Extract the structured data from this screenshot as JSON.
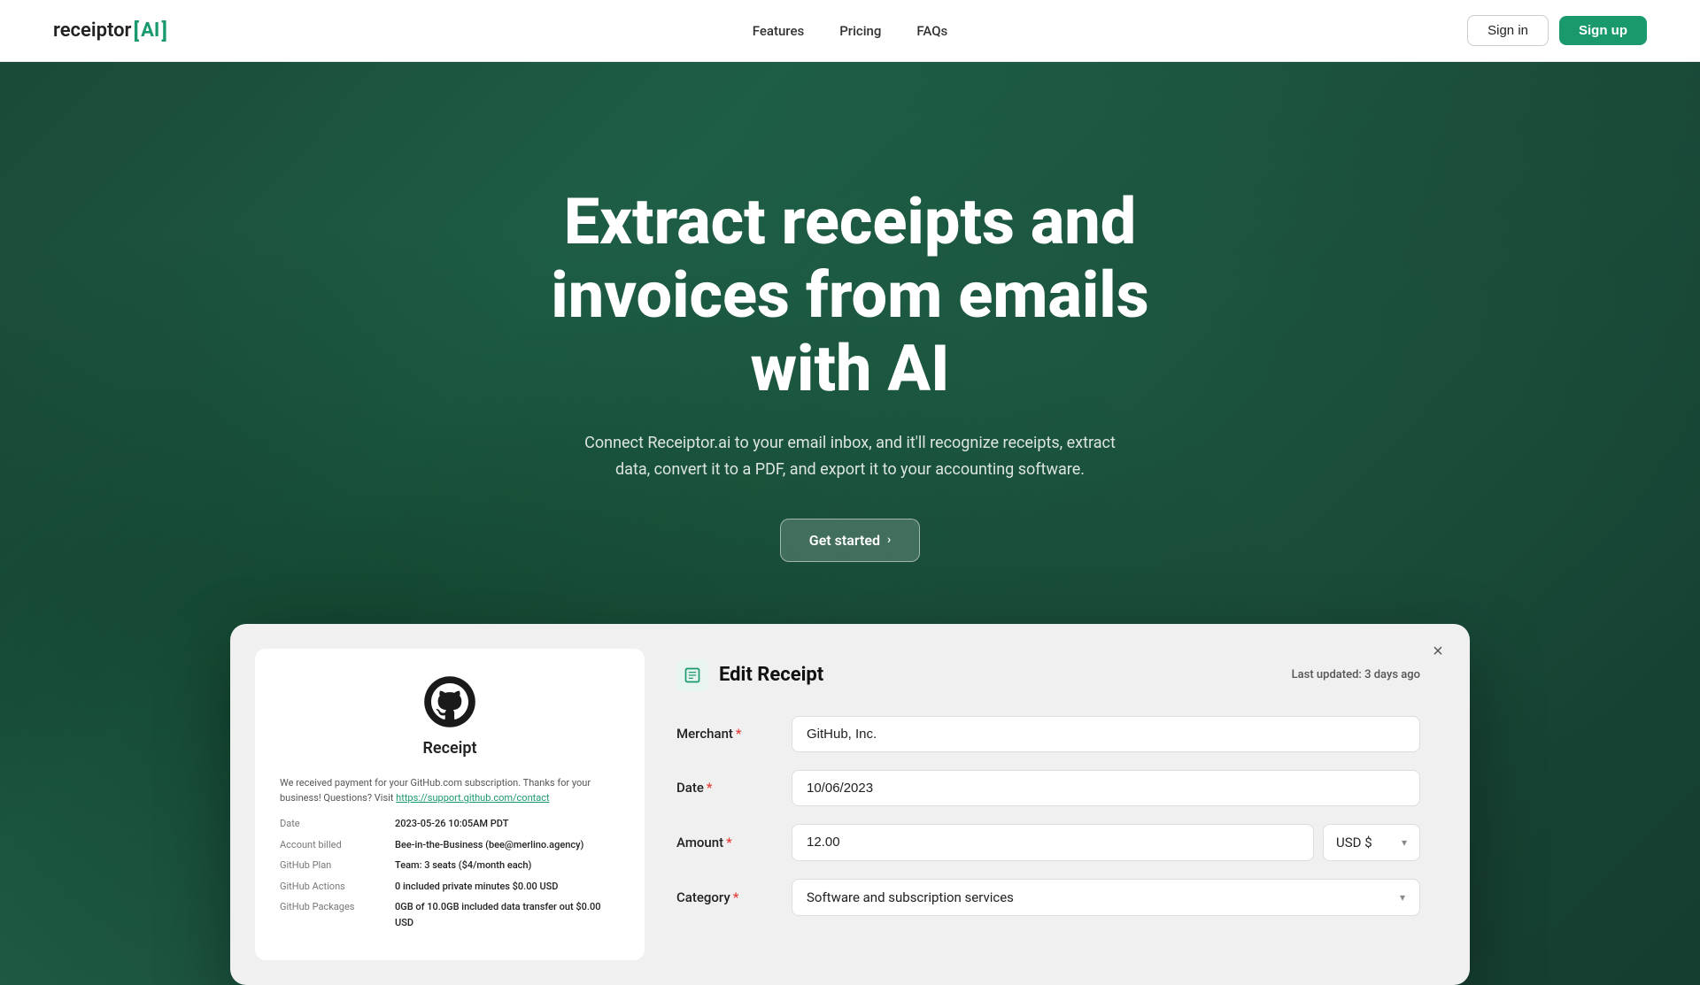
{
  "nav": {
    "logo_text": "receiptor",
    "logo_bracket_open": "[",
    "logo_ai": "AI",
    "logo_bracket_close": "]",
    "links": [
      {
        "label": "Features",
        "href": "#"
      },
      {
        "label": "Pricing",
        "href": "#"
      },
      {
        "label": "FAQs",
        "href": "#"
      }
    ],
    "signin_label": "Sign in",
    "signup_label": "Sign up"
  },
  "hero": {
    "title": "Extract receipts and invoices from emails with AI",
    "subtitle": "Connect Receiptor.ai to your email inbox, and it'll recognize receipts, extract data, convert it to a PDF, and export it to your accounting software.",
    "cta_label": "Get started",
    "cta_arrow": "›"
  },
  "demo": {
    "close_icon": "×",
    "receipt": {
      "title": "Receipt",
      "body_text": "We received payment for your GitHub.com subscription. Thanks for your business! Questions? Visit",
      "body_link": "https://support.github.com/contact",
      "rows": [
        {
          "label": "Date",
          "value": "2023-05-26 10:05AM PDT"
        },
        {
          "label": "Account billed",
          "value": "Bee-in-the-Business (bee@merlino.agency)"
        },
        {
          "label": "GitHub Plan",
          "value": "Team: 3 seats ($4/month each)"
        },
        {
          "label": "GitHub Actions",
          "value": "0 included private minutes $0.00 USD"
        },
        {
          "label": "GitHub Packages",
          "value": "0GB of 10.0GB included data transfer out $0.00 USD"
        }
      ]
    },
    "edit_form": {
      "title": "Edit Receipt",
      "last_updated_label": "Last updated:",
      "last_updated_value": "3 days ago",
      "fields": {
        "merchant_label": "Merchant",
        "merchant_value": "GitHub, Inc.",
        "date_label": "Date",
        "date_value": "10/06/2023",
        "amount_label": "Amount",
        "amount_value": "12.00",
        "currency_value": "USD $",
        "category_label": "Category",
        "category_value": "Software and subscription services"
      }
    }
  }
}
